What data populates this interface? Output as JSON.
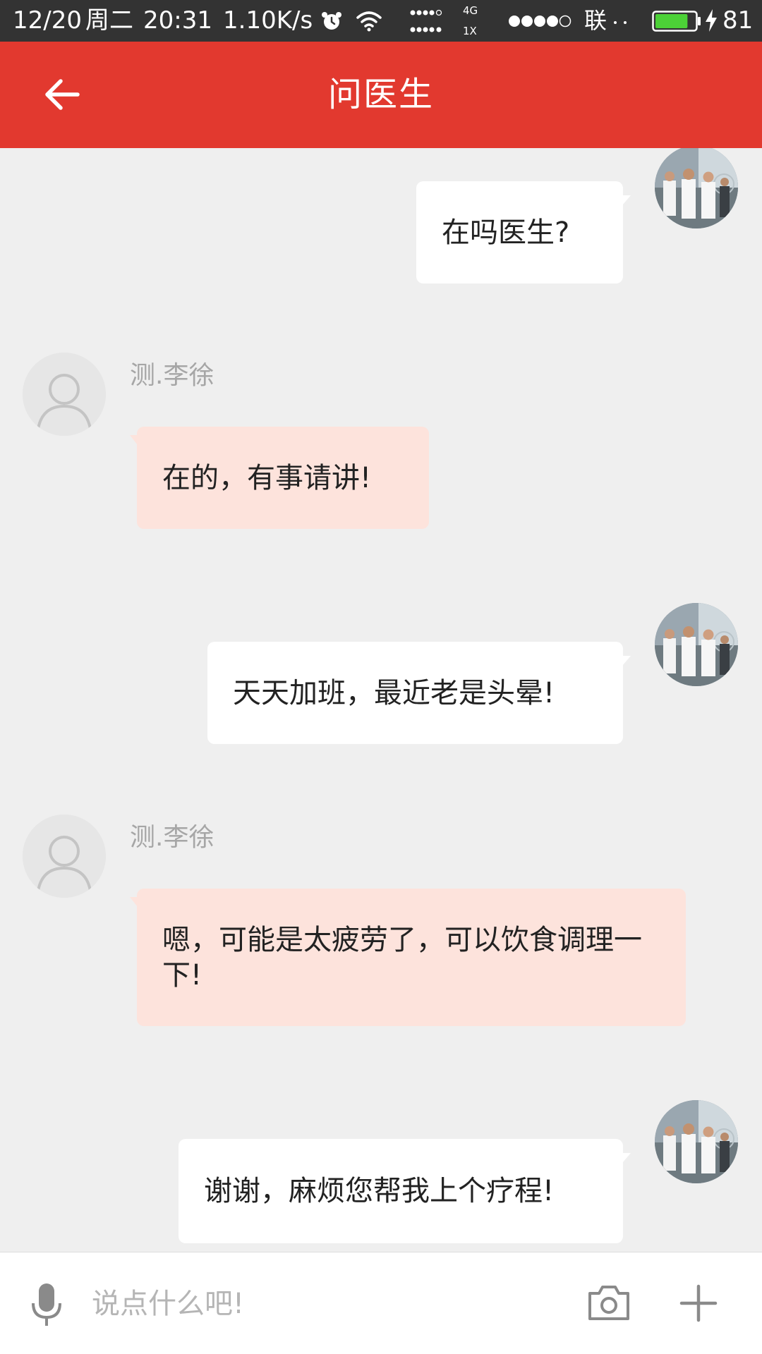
{
  "status_bar": {
    "date": "12/20",
    "weekday": "周二",
    "time": "20:31",
    "net_speed": "1.10K/s",
    "net_type_top": "4G",
    "net_type_bottom": "1X",
    "carrier": "联",
    "battery_percent": "81",
    "battery_level": 0.81,
    "battery_color": "#4cd137",
    "icons": [
      "alarm-icon",
      "wifi-icon",
      "signal-dots-icon",
      "signal-strength-icon",
      "battery-icon",
      "charging-icon"
    ]
  },
  "header": {
    "title": "问医生",
    "background": "#e2392f",
    "back_icon": "arrow-left-icon"
  },
  "chat": {
    "messages": [
      {
        "from": "user",
        "text": "在吗医生?"
      },
      {
        "from": "doctor",
        "sender": "测.李徐",
        "text": "在的，有事请讲!"
      },
      {
        "from": "user",
        "text": "天天加班，最近老是头晕!"
      },
      {
        "from": "doctor",
        "sender": "测.李徐",
        "text": "嗯，可能是太疲劳了，可以饮食调理一下!"
      },
      {
        "from": "user",
        "text": "谢谢，麻烦您帮我上个疗程!"
      }
    ],
    "user_bubble_color": "#ffffff",
    "doctor_bubble_color": "#fde3dc"
  },
  "input_bar": {
    "placeholder": "说点什么吧!",
    "value": "",
    "icons": [
      "microphone-icon",
      "camera-icon",
      "plus-icon"
    ]
  }
}
